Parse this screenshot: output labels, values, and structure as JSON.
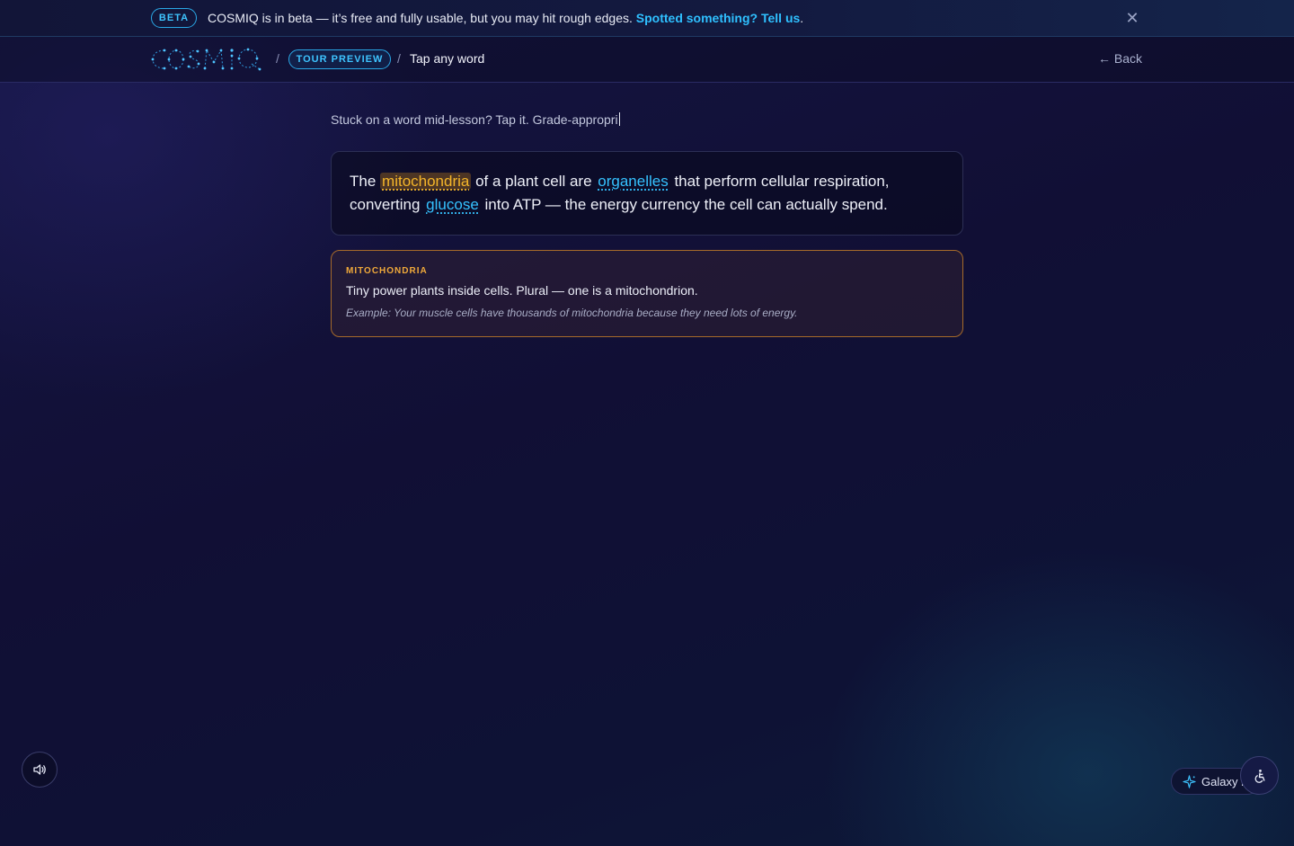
{
  "beta_banner": {
    "badge": "BETA",
    "message": "COSMIQ is in beta — it’s free and fully usable, but you may hit rough edges. ",
    "link": "Spotted something? Tell us",
    "suffix": ".",
    "close_icon": "close-icon"
  },
  "header": {
    "logo_text": "COSMIQ",
    "separator": "/",
    "tour_pill": "TOUR PREVIEW",
    "current": "Tap any word",
    "back": "← Back"
  },
  "main": {
    "typing_text": "Stuck on a word mid-lesson? Tap it. Grade-appropri",
    "sentence": {
      "p1": "The ",
      "w1": "mitochondria",
      "p2": " of a plant cell are ",
      "w2": "organelles",
      "p3": " that perform cellular respiration, converting ",
      "w3": "glucose",
      "p4": " into ATP — the energy currency the cell can actually spend."
    },
    "definition": {
      "term": "MITOCHONDRIA",
      "text": "Tiny power plants inside cells. Plural — one is a mitochondrion.",
      "example": "Example: Your muscle cells have thousands of mitochondria because they need lots of energy."
    }
  },
  "floating": {
    "sound_icon": "speaker-icon",
    "galaxy_label": "Galaxy m",
    "galaxy_icon": "sparkle-icon",
    "a11y_icon": "accessibility-icon"
  },
  "colors": {
    "accent_cyan": "#35c2ff",
    "accent_amber": "#f5b62a",
    "background": "#110f35"
  }
}
